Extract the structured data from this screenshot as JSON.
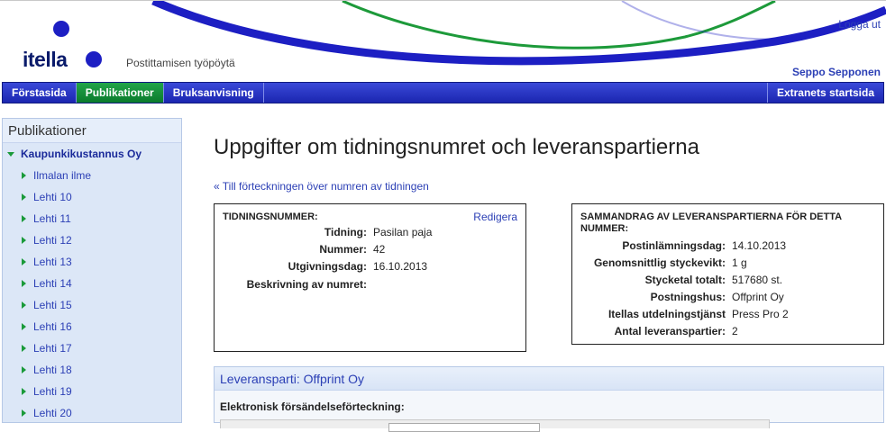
{
  "header": {
    "logo_text": "itella",
    "tagline": "Postittamisen työpöytä",
    "logout": "Logga ut",
    "user": "Seppo Sepponen"
  },
  "nav": {
    "items": [
      "Förstasida",
      "Publikationer",
      "Bruksanvisning"
    ],
    "active": "Publikationer",
    "right": "Extranets startsida"
  },
  "sidebar": {
    "title": "Publikationer",
    "parent": "Kaupunkikustannus Oy",
    "items": [
      "Ilmalan ilme",
      "Lehti 10",
      "Lehti 11",
      "Lehti 12",
      "Lehti 13",
      "Lehti 14",
      "Lehti 15",
      "Lehti 16",
      "Lehti 17",
      "Lehti 18",
      "Lehti 19",
      "Lehti 20"
    ]
  },
  "main": {
    "title": "Uppgifter om tidningsnumret och leveranspartierna",
    "back_link": "« Till förteckningen över numren av tidningen"
  },
  "issue": {
    "heading": "TIDNINGSNUMMER:",
    "edit": "Redigera",
    "fields": [
      {
        "label": "Tidning:",
        "value": "Pasilan paja"
      },
      {
        "label": "Nummer:",
        "value": "42"
      },
      {
        "label": "Utgivningsdag:",
        "value": "16.10.2013"
      },
      {
        "label": "Beskrivning av numret:",
        "value": ""
      }
    ]
  },
  "summary": {
    "heading_line1": "SAMMANDRAG AV LEVERANSPARTIERNA FÖR DETTA",
    "heading_line2": "NUMMER:",
    "fields": [
      {
        "label": "Postinlämningsdag:",
        "value": "14.10.2013"
      },
      {
        "label": "Genomsnittlig styckevikt:",
        "value": "1 g"
      },
      {
        "label": "Stycketal totalt:",
        "value": "517680 st."
      },
      {
        "label": "Postningshus:",
        "value": "Offprint Oy"
      },
      {
        "label": "Itellas utdelningstjänst",
        "value": "Press Pro 2"
      },
      {
        "label": "Antal leveranspartier:",
        "value": "2"
      }
    ]
  },
  "delivery": {
    "heading": "Leveransparti: Offprint Oy",
    "subheading": "Elektronisk försändelseförteckning:"
  },
  "colors": {
    "nav_blue": "#1b26b0",
    "nav_active_green": "#0b7a2c",
    "link_blue": "#2b3fb5",
    "sidebar_bg": "#dce7f7"
  }
}
